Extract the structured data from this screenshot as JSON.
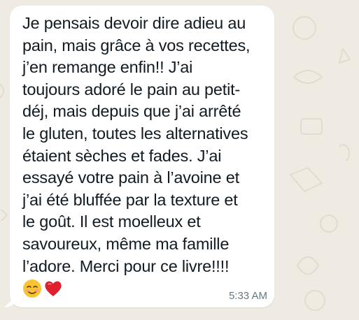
{
  "chat": {
    "background_color": "#efeae2",
    "message": {
      "text": "Je pensais devoir dire adieu au\npain, mais grâce à vos recettes,\nj’en remange enfin!! J’ai\ntoujours adoré le pain au petit-\ndéj, mais depuis que j’ai arrêté\nle gluten, toutes les alternatives\nétaient sèches et fades. J’ai\nessayé votre pain à l’avoine et\nj’ai été bluffée par la texture et\nle goût. Il est moelleux et\nsavoureux, même ma famille\nl’adore. Merci pour ce livre!!!!",
      "emojis": [
        "smiling-face-icon",
        "red-heart-icon"
      ],
      "time": "5:33 AM",
      "bubble_color": "#ffffff",
      "text_color": "#111b21",
      "time_color": "#667781"
    }
  }
}
